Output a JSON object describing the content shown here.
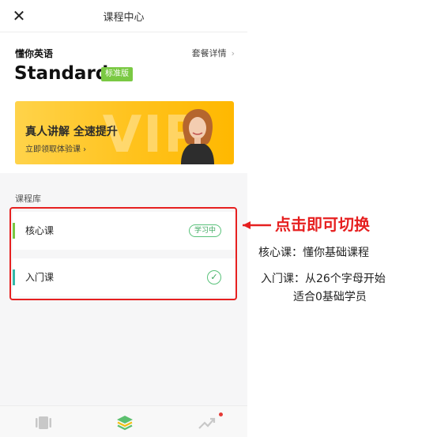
{
  "header": {
    "title": "课程中心",
    "close_icon": "close-icon"
  },
  "plan": {
    "brand": "懂你英语",
    "details_link": "套餐详情",
    "tier": "Standard",
    "tier_badge": "标准版"
  },
  "banner": {
    "decoration": "VIP",
    "headline": "真人讲解 全速提升",
    "cta": "立即领取体验课 ›"
  },
  "library": {
    "label": "课程库",
    "courses": [
      {
        "name": "核心课",
        "status": "学习中",
        "bar_color": "#7ac943"
      },
      {
        "name": "入门课",
        "status_icon": "check-circle-icon",
        "bar_color": "#35b8a8"
      }
    ]
  },
  "tabbar": {
    "tabs": [
      {
        "icon": "cards-icon"
      },
      {
        "icon": "layers-icon",
        "active": true
      },
      {
        "icon": "trend-icon",
        "badge": "dot"
      }
    ]
  },
  "annotation": {
    "title": "点击即可切换",
    "line1": "核心课：懂你基础课程",
    "line2": "入门课：从26个字母开始",
    "line3": "适合0基础学员"
  },
  "colors": {
    "accent_red": "#e62020",
    "green": "#59c27a",
    "banner_yellow": "#ffc21c"
  }
}
